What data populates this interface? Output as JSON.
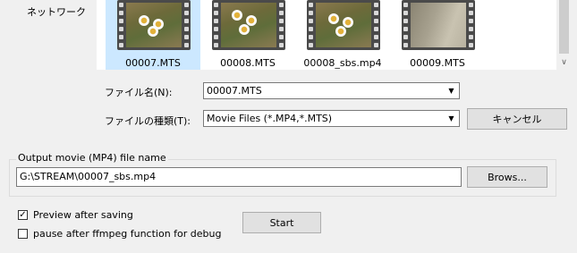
{
  "nav": {
    "network_label": "ネットワーク"
  },
  "files": [
    {
      "name": "00007.MTS",
      "selected": true,
      "thumbnail": "flowers"
    },
    {
      "name": "00008.MTS",
      "selected": false,
      "thumbnail": "flowers"
    },
    {
      "name": "00008_sbs.mp4",
      "selected": false,
      "thumbnail": "flowers"
    },
    {
      "name": "00009.MTS",
      "selected": false,
      "thumbnail": "sand"
    }
  ],
  "filename_row": {
    "label": "ファイル名(N):",
    "value": "00007.MTS"
  },
  "filetype_row": {
    "label": "ファイルの種類(T):",
    "value": "Movie Files (*.MP4,*.MTS)"
  },
  "cancel_button": "キャンセル",
  "output_group": {
    "title": "Output movie (MP4) file name",
    "path": "G:\\STREAM\\00007_sbs.mp4",
    "browse_button": "Brows..."
  },
  "options": {
    "preview_label": "Preview after saving",
    "preview_checked": true,
    "pause_label": "pause after ffmpeg function for debug",
    "pause_checked": false
  },
  "start_button": "Start",
  "colors": {
    "selected_bg": "#cce8ff",
    "window_bg": "#f0f0f0"
  }
}
